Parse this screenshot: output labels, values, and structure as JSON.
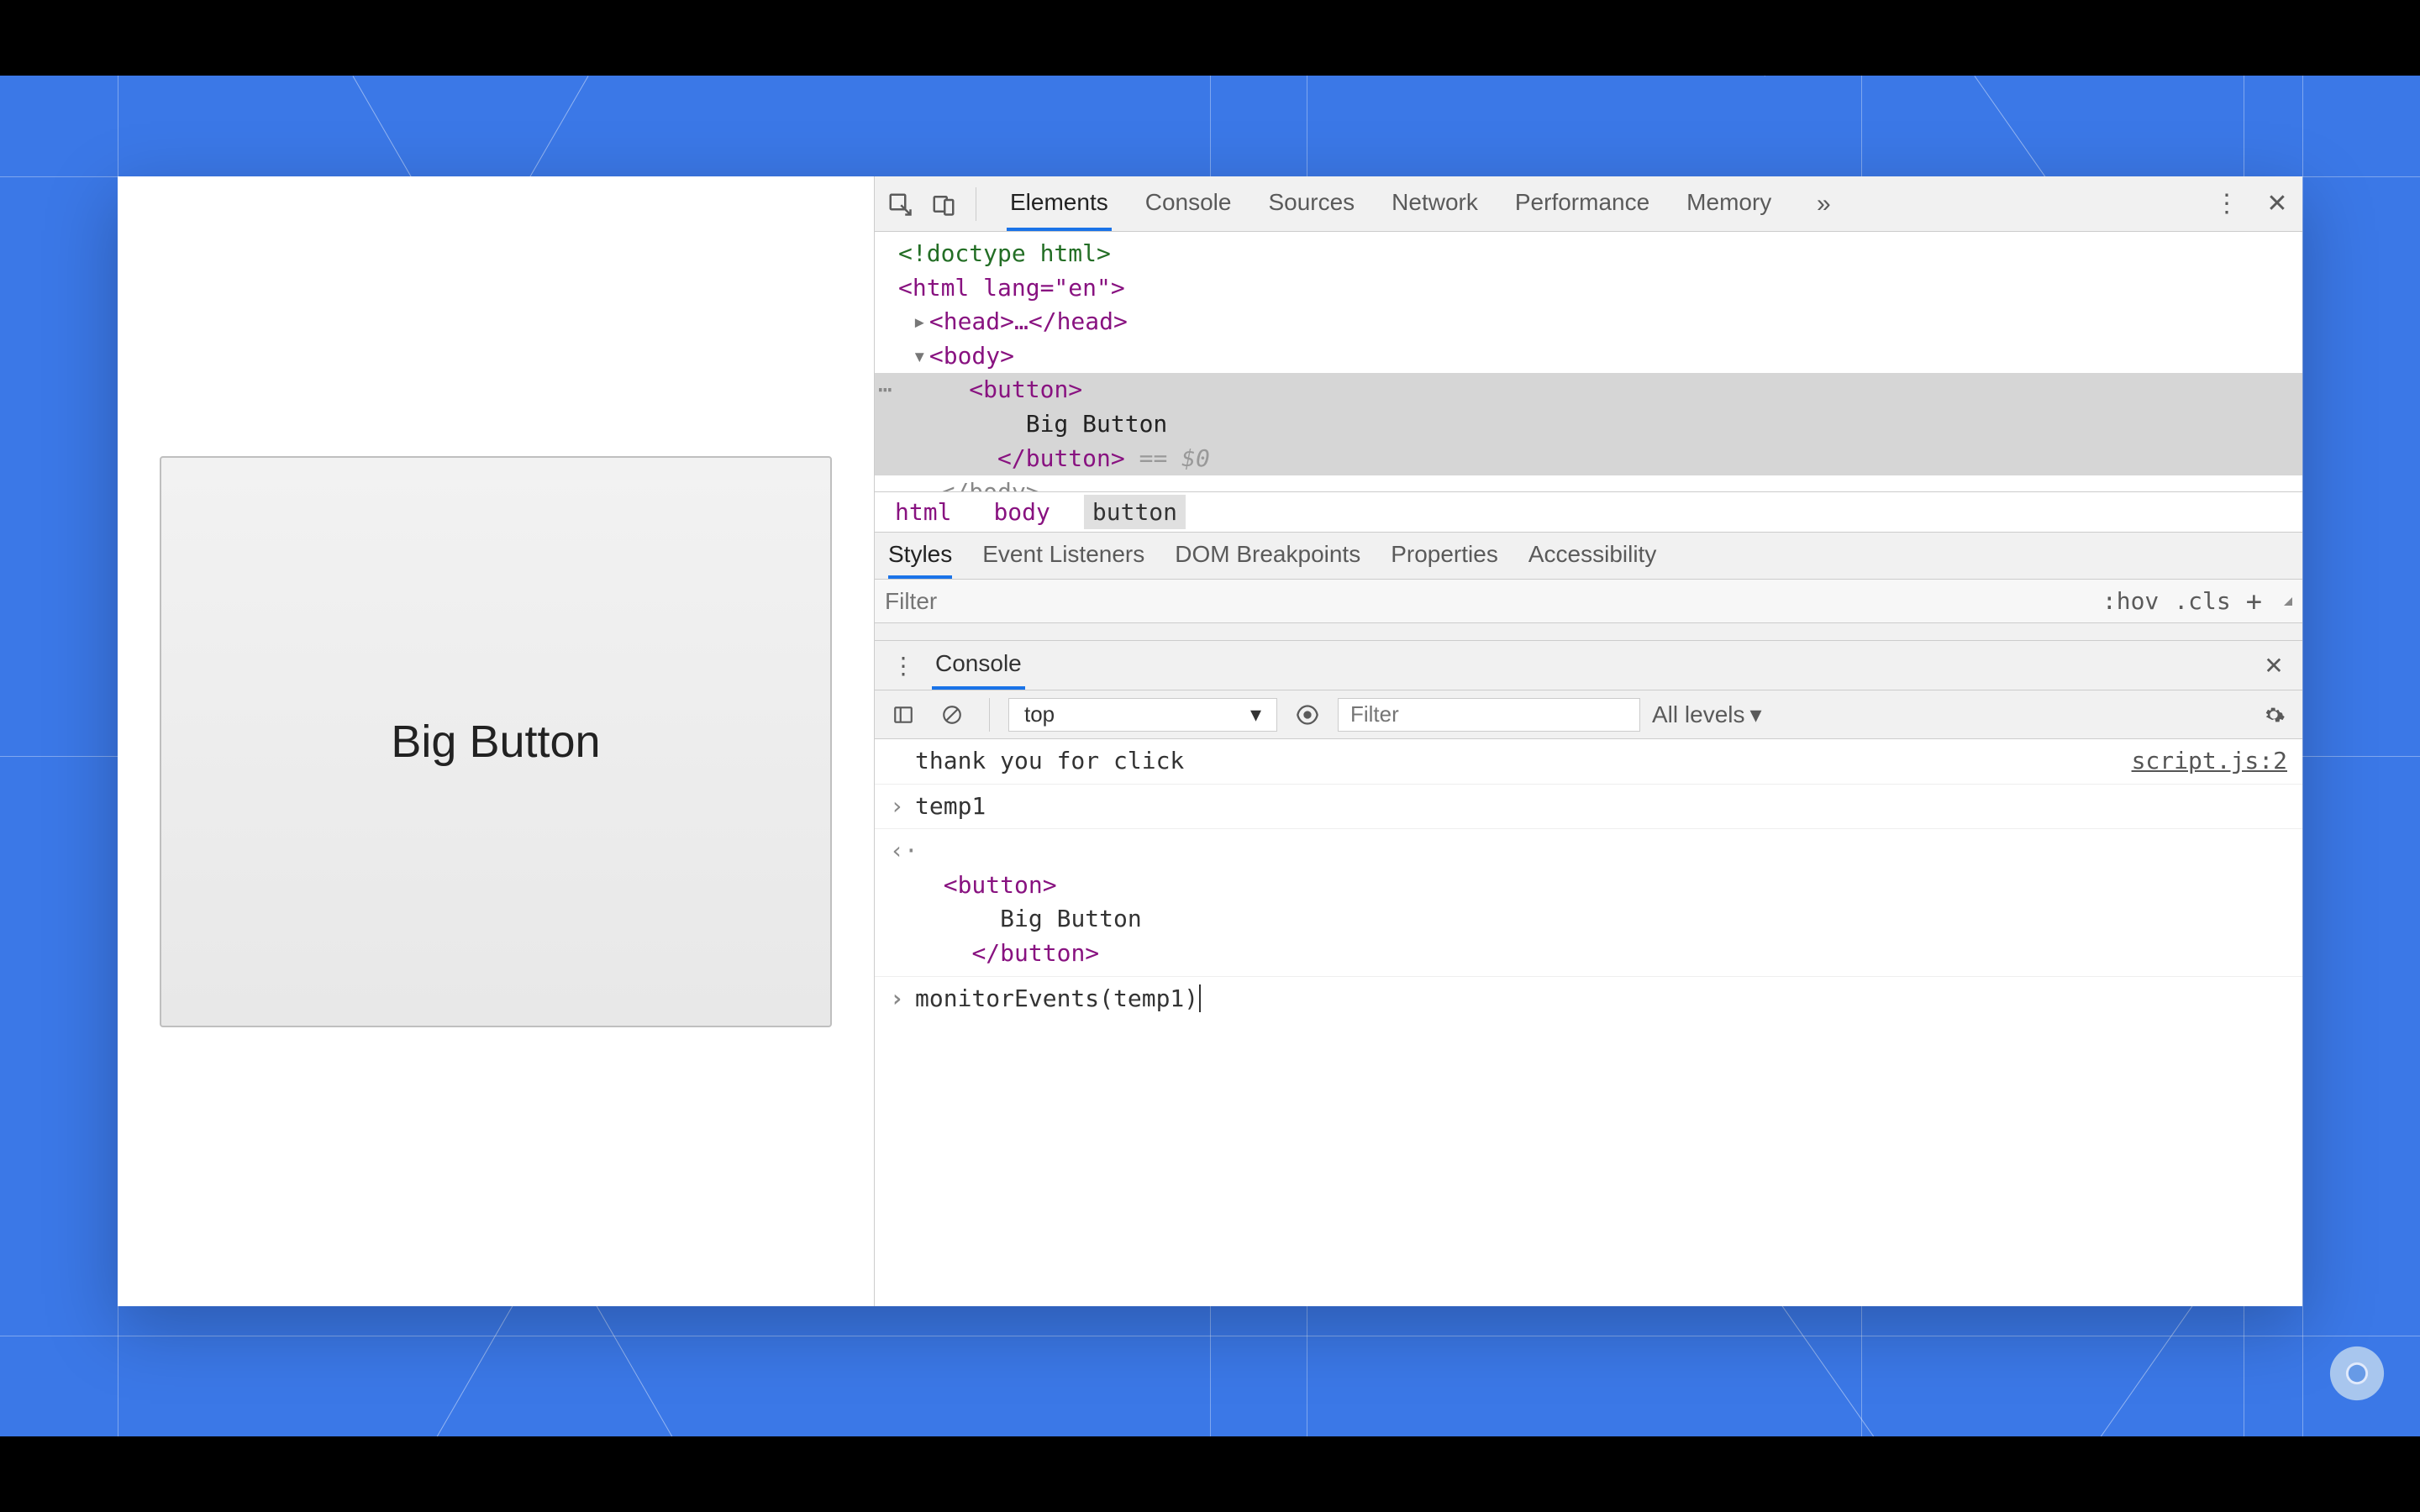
{
  "page": {
    "button_label": "Big Button"
  },
  "devtools": {
    "tabs": [
      "Elements",
      "Console",
      "Sources",
      "Network",
      "Performance",
      "Memory"
    ],
    "active_tab": "Elements",
    "dom": {
      "doctype": "<!doctype html>",
      "html_open": "<html lang=\"en\">",
      "head": "<head>…</head>",
      "body_open": "<body>",
      "button_open": "<button>",
      "button_text": "Big Button",
      "button_close": "</button>",
      "eq0": " == $0",
      "body_close": "</body>"
    },
    "breadcrumbs": [
      "html",
      "body",
      "button"
    ],
    "subtabs": [
      "Styles",
      "Event Listeners",
      "DOM Breakpoints",
      "Properties",
      "Accessibility"
    ],
    "active_subtab": "Styles",
    "filter_placeholder": "Filter",
    "hov": ":hov",
    "cls": ".cls"
  },
  "console": {
    "title": "Console",
    "context": "top",
    "filter_placeholder": "Filter",
    "levels": "All levels",
    "log_msg": "thank you for click",
    "log_source": "script.js:2",
    "line_temp1": "temp1",
    "dom_out_open": "<button>",
    "dom_out_text": "Big Button",
    "dom_out_close": "</button>",
    "input_line": "monitorEvents(temp1)"
  }
}
